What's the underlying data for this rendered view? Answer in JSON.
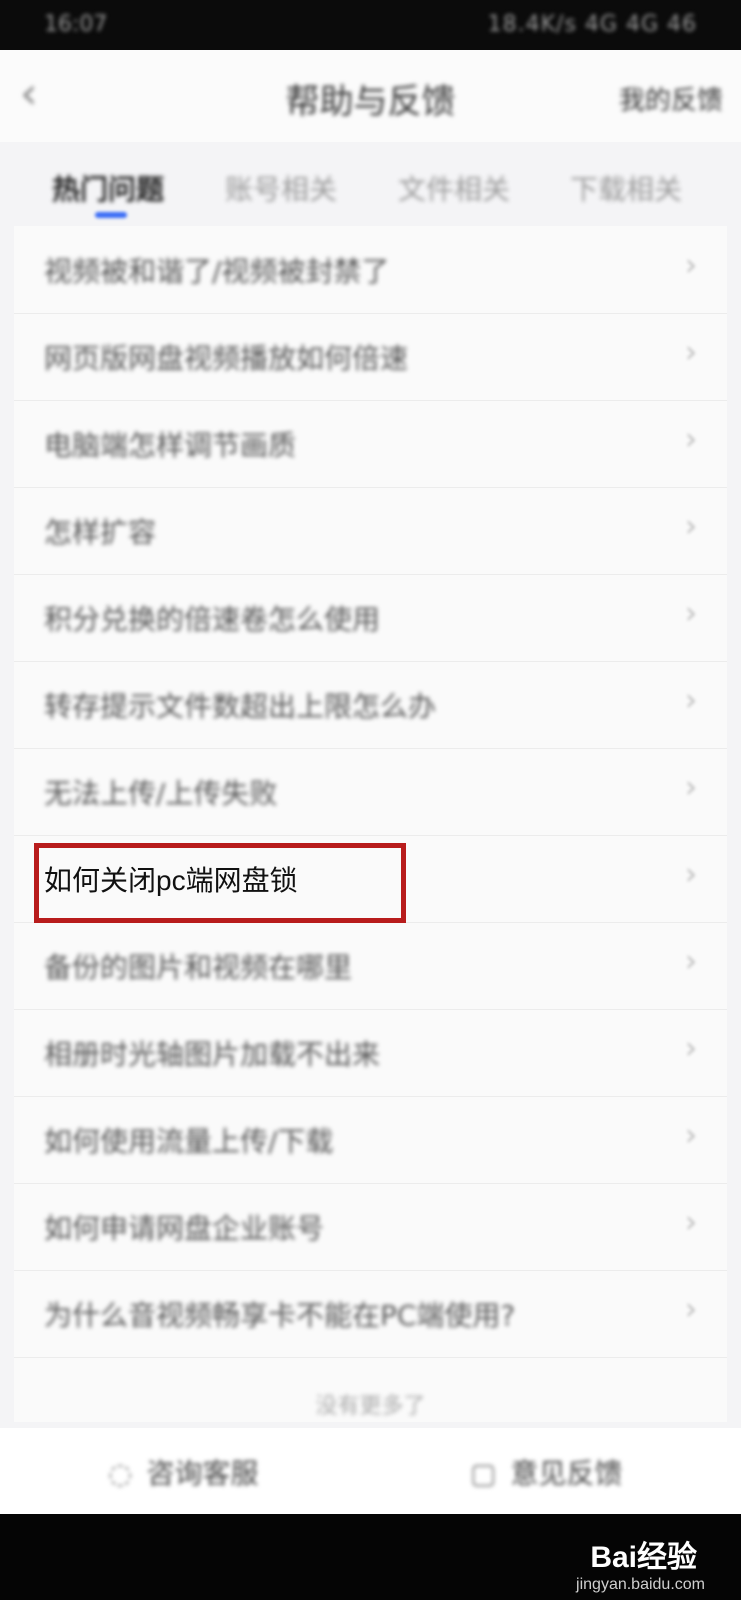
{
  "status_bar": {
    "time": "16:07",
    "indicators": "18.4K/s 4G 4G 46"
  },
  "header": {
    "back_icon": "chevron-left-icon",
    "title": "帮助与反馈",
    "action": "我的反馈"
  },
  "tabs": [
    {
      "label": "热门问题",
      "active": true
    },
    {
      "label": "账号相关",
      "active": false
    },
    {
      "label": "文件相关",
      "active": false
    },
    {
      "label": "下载相关",
      "active": false
    }
  ],
  "questions": [
    {
      "label": "视频被和谐了/视频被封禁了"
    },
    {
      "label": "网页版网盘视频播放如何倍速"
    },
    {
      "label": "电脑端怎样调节画质"
    },
    {
      "label": "怎样扩容"
    },
    {
      "label": "积分兑换的倍速卷怎么使用"
    },
    {
      "label": "转存提示文件数超出上限怎么办"
    },
    {
      "label": "无法上传/上传失败"
    },
    {
      "label": "如何关闭pc端网盘锁",
      "highlighted": true
    },
    {
      "label": "备份的图片和视频在哪里"
    },
    {
      "label": "相册时光轴图片加载不出来"
    },
    {
      "label": "如何使用流量上传/下载"
    },
    {
      "label": "如何申请网盘企业账号"
    },
    {
      "label": "为什么音视频畅享卡不能在PC端使用?"
    }
  ],
  "footer_note": "没有更多了",
  "bottom_bar": {
    "consult": {
      "icon": "headset-icon",
      "label": "咨询客服"
    },
    "feedback": {
      "icon": "edit-icon",
      "label": "意见反馈"
    }
  },
  "watermark": {
    "logo": "Bai经验",
    "url": "jingyan.baidu.com"
  },
  "colors": {
    "accent": "#3a6cf5",
    "highlight_border": "#b81c1c"
  }
}
